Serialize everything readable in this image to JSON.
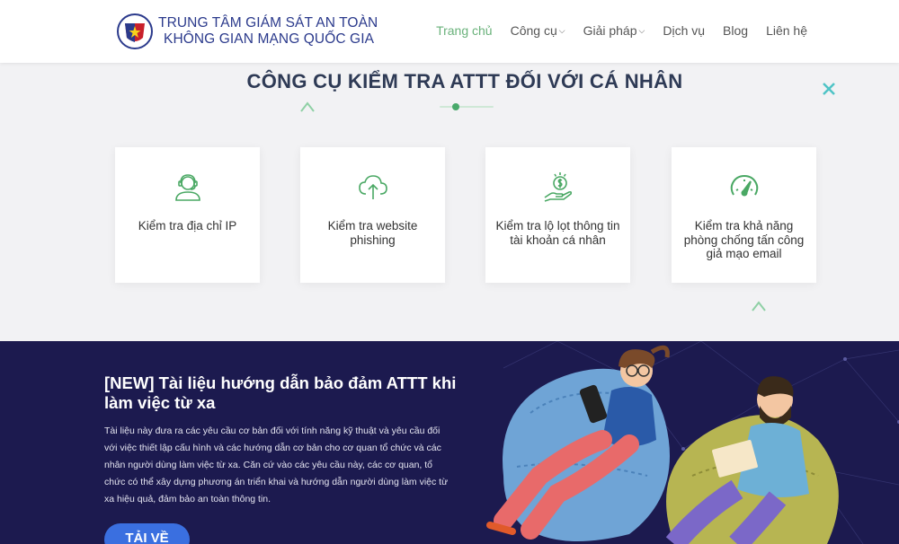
{
  "header": {
    "brand_line1": "TRUNG TÂM GIÁM SÁT AN TOÀN",
    "brand_line2": "KHÔNG GIAN MẠNG QUỐC GIA",
    "nav": [
      {
        "label": "Trang chủ",
        "active": true,
        "dropdown": false
      },
      {
        "label": "Công cụ",
        "active": false,
        "dropdown": true
      },
      {
        "label": "Giải pháp",
        "active": false,
        "dropdown": true
      },
      {
        "label": "Dịch vụ",
        "active": false,
        "dropdown": false
      },
      {
        "label": "Blog",
        "active": false,
        "dropdown": false
      },
      {
        "label": "Liên hệ",
        "active": false,
        "dropdown": false
      }
    ]
  },
  "tools": {
    "title": "CÔNG CỤ KIỂM TRA ATTT ĐỐI VỚI CÁ NHÂN",
    "cards": [
      {
        "label": "Kiểm tra địa chỉ IP",
        "icon": "user-headset-icon"
      },
      {
        "label": "Kiểm tra website phishing",
        "icon": "cloud-upload-icon"
      },
      {
        "label": "Kiểm tra lộ lọt thông tin tài khoản cá nhân",
        "icon": "money-hand-icon"
      },
      {
        "label": "Kiểm tra khả năng phòng chống tấn công giả mạo email",
        "icon": "speedometer-icon"
      }
    ]
  },
  "banner": {
    "title": "[NEW] Tài liệu hướng dẫn bảo đảm ATTT khi làm việc từ xa",
    "text": "Tài liệu này đưa ra các yêu cầu cơ bản đối với tính năng kỹ thuật và yêu cầu đối với việc thiết lập cấu hình và các hướng dẫn cơ bản cho cơ quan tổ chức và các nhân người dùng làm việc từ xa. Căn cứ vào các yêu cầu này, các cơ quan, tổ chức có thể xây dựng phương án triển khai và hướng dẫn người dùng làm việc từ xa hiệu quả, đảm bảo an toàn thông tin.",
    "button": "TẢI VỀ"
  },
  "colors": {
    "accent_green": "#6ab27b",
    "brand_blue": "#2b3a8c",
    "banner_bg": "#1c1a4f",
    "button_blue": "#3a6fe0"
  }
}
